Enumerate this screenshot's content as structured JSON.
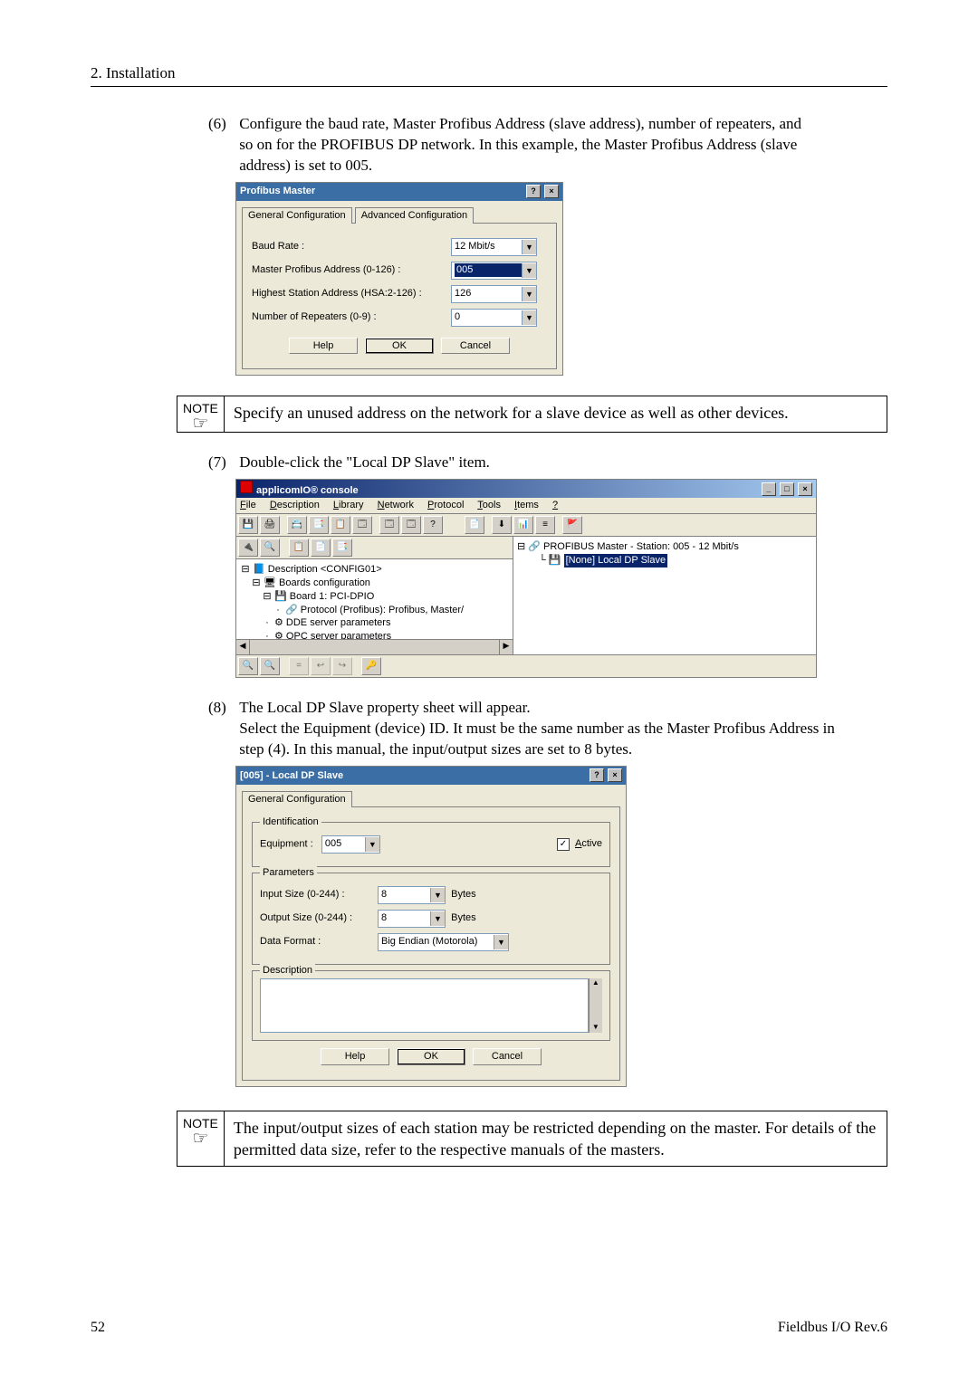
{
  "header": "2. Installation",
  "step6_num": "(6)",
  "step6_text": "Configure the baud rate, Master Profibus Address (slave address), number of repeaters, and so on for the PROFIBUS DP network.  In this example, the Master Profibus Address (slave address) is set to 005.",
  "dlg1": {
    "title": "Profibus Master",
    "tab1": "General Configuration",
    "tab2": "Advanced Configuration",
    "baud_lbl": "Baud Rate :",
    "baud_val": "12 Mbit/s",
    "addr_lbl": "Master Profibus Address  (0-126) :",
    "addr_val": "005",
    "hsa_lbl": "Highest Station Address (HSA:2-126) :",
    "hsa_val": "126",
    "rep_lbl": "Number of Repeaters (0-9) :",
    "rep_val": "0",
    "help": "Help",
    "ok": "OK",
    "cancel": "Cancel"
  },
  "note_label": "NOTE",
  "note1": "Specify an unused address on the network for a slave device as well as other devices.",
  "step7_num": "(7)",
  "step7_text": "Double-click the \"Local DP Slave\" item.",
  "console": {
    "title": "applicomIO® console",
    "menus": [
      "File",
      "Description",
      "Library",
      "Network",
      "Protocol",
      "Tools",
      "Items",
      "?"
    ],
    "tree_top": "Description <CONFIG01>",
    "tree_boards": "Boards configuration",
    "tree_board1": "Board 1:    PCI-DPIO",
    "tree_proto": "Protocol (Profibus): Profibus, Master/",
    "tree_dde": "DDE server parameters",
    "tree_opc": "OPC server parameters",
    "right_master": "PROFIBUS Master  - Station: 005 - 12 Mbit/s",
    "right_slave": "[None]  Local DP Slave"
  },
  "step8_num": "(8)",
  "step8_text_l1": "The Local DP Slave property sheet will appear.",
  "step8_text_l2": "Select the Equipment (device) ID.  It must be the same number as the Master Profibus Address in step (4).  In this manual, the input/output sizes are set to 8 bytes.",
  "dlg2": {
    "title": "[005] - Local DP Slave",
    "tab1": "General Configuration",
    "equip_lbl": "Equipment :",
    "equip_val": "005",
    "active_lbl": "Active",
    "in_lbl": "Input Size (0-244) :",
    "in_val": "8",
    "out_lbl": "Output Size (0-244) :",
    "out_val": "8",
    "fmt_lbl": "Data Format :",
    "fmt_val": "Big Endian (Motorola)",
    "bytes": "Bytes",
    "grp_ident": "Identification",
    "grp_params": "Parameters",
    "grp_desc": "Description",
    "help": "Help",
    "ok": "OK",
    "cancel": "Cancel"
  },
  "note2": "The input/output sizes of each station may be restricted depending on the master.  For details of the permitted data size, refer to the respective manuals of the masters.",
  "page_num": "52",
  "doc_rev": "Fieldbus I/O Rev.6"
}
